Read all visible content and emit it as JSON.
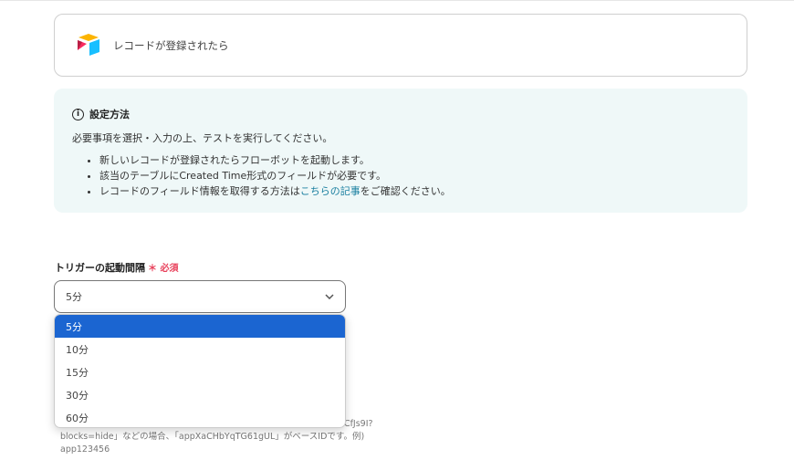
{
  "trigger": {
    "title": "レコードが登録されたら",
    "icon": "airtable-logo"
  },
  "info": {
    "heading": "設定方法",
    "description": "必要事項を選択・入力の上、テストを実行してください。",
    "bullets": [
      {
        "text": "新しいレコードが登録されたらフローボットを起動します。"
      },
      {
        "text": "該当のテーブルにCreated Time形式のフィールドが必要です。"
      },
      {
        "before": "レコードのフィールド情報を取得する方法は",
        "link": "こちらの記事",
        "after": "をご確認ください。"
      }
    ],
    "link_color": "#1a7fa0"
  },
  "field": {
    "label": "トリガーの起動間隔",
    "required": "必須",
    "value": "5分",
    "options": [
      "5分",
      "10分",
      "15分",
      "30分",
      "60分"
    ],
    "selected_index": 0
  },
  "hint": {
    "line1_tail": "UCfJs9I?",
    "line2": "blocks=hide」などの場合、「appXaCHbYqTG61gUL」がベースIDです。例)",
    "line3": "app123456"
  },
  "colors": {
    "accent": "#1b65d1",
    "required": "#e8405a",
    "info_bg": "#eff8f8"
  }
}
